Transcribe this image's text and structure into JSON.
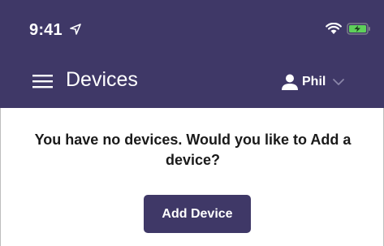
{
  "colors": {
    "header_bg": "#3f3867",
    "primary_button": "#3f3867",
    "battery_fill": "#5ed05a",
    "text_dark": "#1a1a1a"
  },
  "status_bar": {
    "time": "9:41",
    "icons": [
      "location-arrow-icon",
      "wifi-icon",
      "battery-charging-icon"
    ]
  },
  "nav": {
    "menu_icon": "hamburger-menu-icon",
    "title": "Devices",
    "user": {
      "icon": "user-icon",
      "name": "Phil",
      "dropdown_icon": "chevron-down-icon"
    }
  },
  "content": {
    "empty_message": "You have no devices. Would you like to Add a device?",
    "add_button_label": "Add Device"
  }
}
